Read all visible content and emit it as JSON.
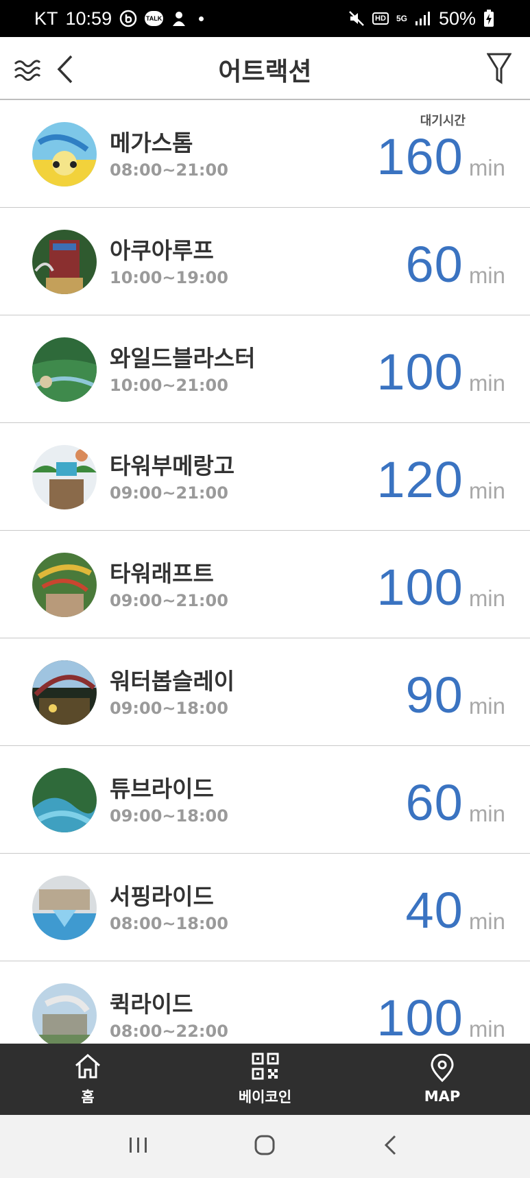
{
  "status_bar": {
    "carrier": "KT",
    "time": "10:59",
    "talk_badge": "TALK",
    "hd_badge": "HD",
    "network": "5G",
    "battery": "50%"
  },
  "app_bar": {
    "title": "어트랙션"
  },
  "wait_header": "대기시간",
  "attractions": [
    {
      "name": "메가스톰",
      "hours": "08:00~21:00",
      "wait": "160",
      "unit": "min"
    },
    {
      "name": "아쿠아루프",
      "hours": "10:00~19:00",
      "wait": "60",
      "unit": "min"
    },
    {
      "name": "와일드블라스터",
      "hours": "10:00~21:00",
      "wait": "100",
      "unit": "min"
    },
    {
      "name": "타워부메랑고",
      "hours": "09:00~21:00",
      "wait": "120",
      "unit": "min"
    },
    {
      "name": "타워래프트",
      "hours": "09:00~21:00",
      "wait": "100",
      "unit": "min"
    },
    {
      "name": "워터봅슬레이",
      "hours": "09:00~18:00",
      "wait": "90",
      "unit": "min"
    },
    {
      "name": "튜브라이드",
      "hours": "09:00~18:00",
      "wait": "60",
      "unit": "min"
    },
    {
      "name": "서핑라이드",
      "hours": "08:00~18:00",
      "wait": "40",
      "unit": "min"
    },
    {
      "name": "퀵라이드",
      "hours": "08:00~22:00",
      "wait": "100",
      "unit": "min"
    }
  ],
  "bottom_nav": {
    "home": "홈",
    "becoin": "베이코인",
    "map": "MAP"
  },
  "colors": {
    "wait_value": "#3a73c1",
    "nav_background": "#2f2f2f",
    "status_background": "#000000"
  }
}
